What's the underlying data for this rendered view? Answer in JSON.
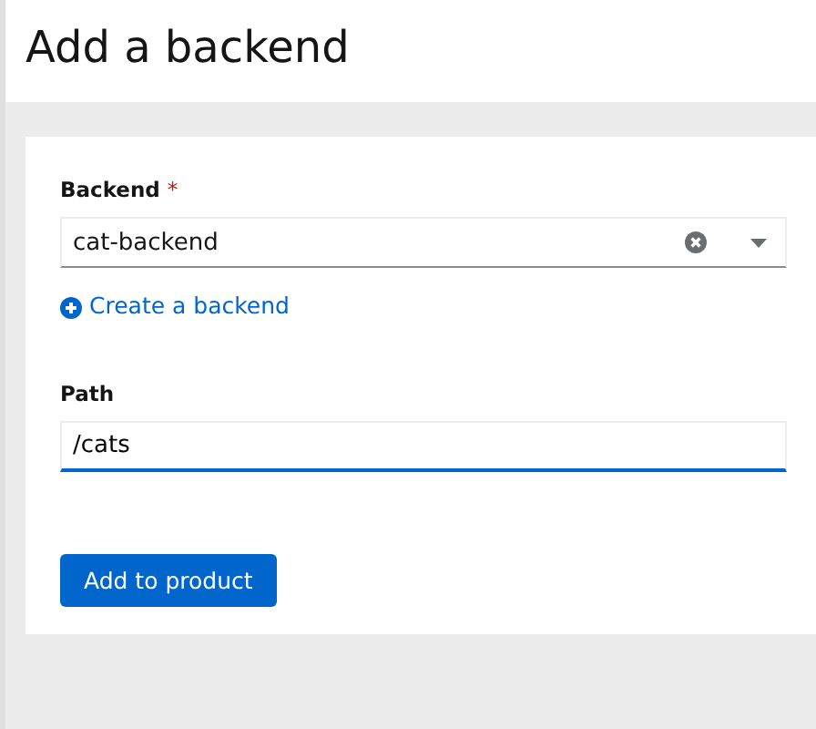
{
  "page": {
    "title": "Add a backend"
  },
  "form": {
    "backend": {
      "label": "Backend",
      "required_mark": "*",
      "value": "cat-backend"
    },
    "create_link": {
      "label": "Create a backend"
    },
    "path": {
      "label": "Path",
      "value": "/cats",
      "focused": true
    },
    "submit": {
      "label": "Add to product"
    }
  }
}
